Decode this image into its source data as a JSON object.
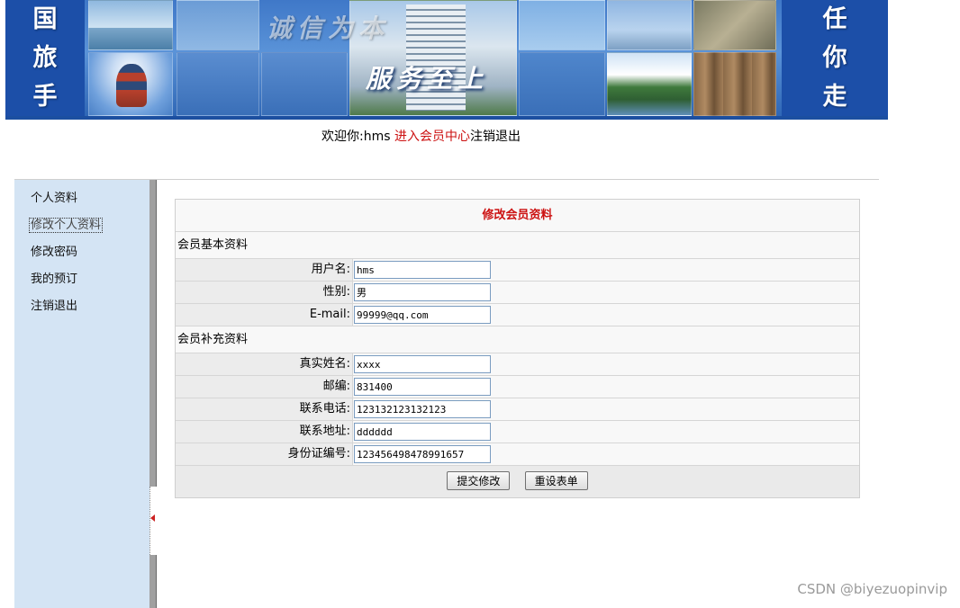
{
  "banner": {
    "left_chars": [
      "国",
      "旅",
      "手"
    ],
    "right_chars": [
      "任",
      "你",
      "走"
    ],
    "slogan_top": "诚信为本",
    "slogan_main": "服务至上"
  },
  "welcome": {
    "prefix": "欢迎你:",
    "username": "hms",
    "member_center": "进入会员中心",
    "logout": "注销退出"
  },
  "sidebar": {
    "items": [
      {
        "label": "个人资料"
      },
      {
        "label": "修改个人资料",
        "active": true
      },
      {
        "label": "修改密码"
      },
      {
        "label": "我的预订"
      },
      {
        "label": "注销退出"
      }
    ]
  },
  "form": {
    "title": "修改会员资料",
    "basic_section": "会员基本资料",
    "basic_fields": [
      {
        "label": "用户名:",
        "value": "hms"
      },
      {
        "label": "性别:",
        "value": "男"
      },
      {
        "label": "E-mail:",
        "value": "99999@qq.com"
      }
    ],
    "extra_section": "会员补充资料",
    "extra_fields": [
      {
        "label": "真实姓名:",
        "value": "xxxx"
      },
      {
        "label": "邮编:",
        "value": "831400"
      },
      {
        "label": "联系电话:",
        "value": "123132123132123"
      },
      {
        "label": "联系地址:",
        "value": "dddddd"
      },
      {
        "label": "身份证编号:",
        "value": "123456498478991657"
      }
    ],
    "submit_label": "提交修改",
    "reset_label": "重设表单"
  },
  "watermark": "CSDN @biyezuopinvip",
  "colors": {
    "accent_red": "#cc1111",
    "sidebar_bg": "#d4e4f4",
    "banner_blue": "#1c4fa8"
  }
}
